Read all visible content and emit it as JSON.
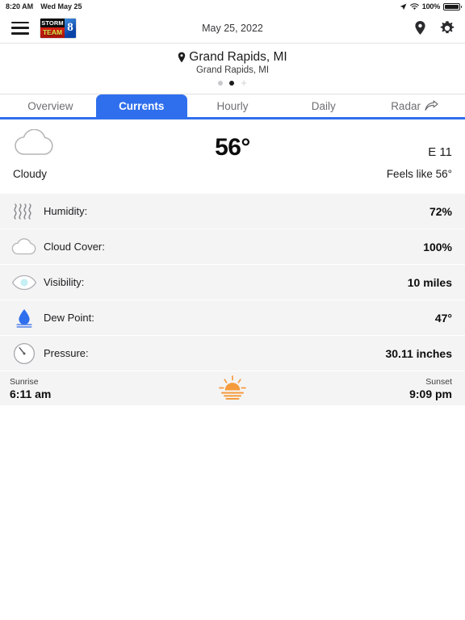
{
  "status_bar": {
    "time": "8:20 AM",
    "date": "Wed May 25",
    "battery_percent": "100%",
    "location_icon": "location-arrow-icon",
    "wifi_icon": "wifi-icon",
    "battery_icon": "battery-full-icon"
  },
  "header": {
    "menu_icon": "hamburger-menu-icon",
    "logo": {
      "line1": "STORM",
      "line2": "TEAM",
      "channel": "8"
    },
    "date": "May 25, 2022",
    "location_pin_icon": "map-pin-icon",
    "settings_icon": "gear-icon"
  },
  "location": {
    "pin_icon": "map-pin-icon",
    "primary": "Grand Rapids, MI",
    "secondary": "Grand Rapids, MI",
    "pager": {
      "dots": [
        {
          "active": false
        },
        {
          "active": true
        }
      ],
      "add_label": "+"
    }
  },
  "tabs": {
    "items": [
      {
        "label": "Overview",
        "active": false,
        "icon": ""
      },
      {
        "label": "Currents",
        "active": true,
        "icon": ""
      },
      {
        "label": "Hourly",
        "active": false,
        "icon": ""
      },
      {
        "label": "Daily",
        "active": false,
        "icon": ""
      },
      {
        "label": "Radar",
        "active": false,
        "icon": "share-arrow-icon"
      }
    ],
    "active_color": "#2f6fed"
  },
  "current": {
    "condition_icon": "cloud-icon",
    "condition": "Cloudy",
    "temperature": "56°",
    "wind": "E 11",
    "feels_like": "Feels like 56°"
  },
  "details": [
    {
      "icon": "humidity-waves-icon",
      "label": "Humidity:",
      "value": "72%"
    },
    {
      "icon": "cloud-icon",
      "label": "Cloud Cover:",
      "value": "100%"
    },
    {
      "icon": "eye-visibility-icon",
      "label": "Visibility:",
      "value": "10 miles"
    },
    {
      "icon": "water-drop-icon",
      "label": "Dew Point:",
      "value": "47°"
    },
    {
      "icon": "pressure-gauge-icon",
      "label": "Pressure:",
      "value": "30.11 inches"
    }
  ],
  "sun": {
    "sunrise_label": "Sunrise",
    "sunrise_time": "6:11 am",
    "sunset_label": "Sunset",
    "sunset_time": "9:09 pm",
    "icon": "sunrise-icon",
    "icon_color": "#f59b3c"
  }
}
